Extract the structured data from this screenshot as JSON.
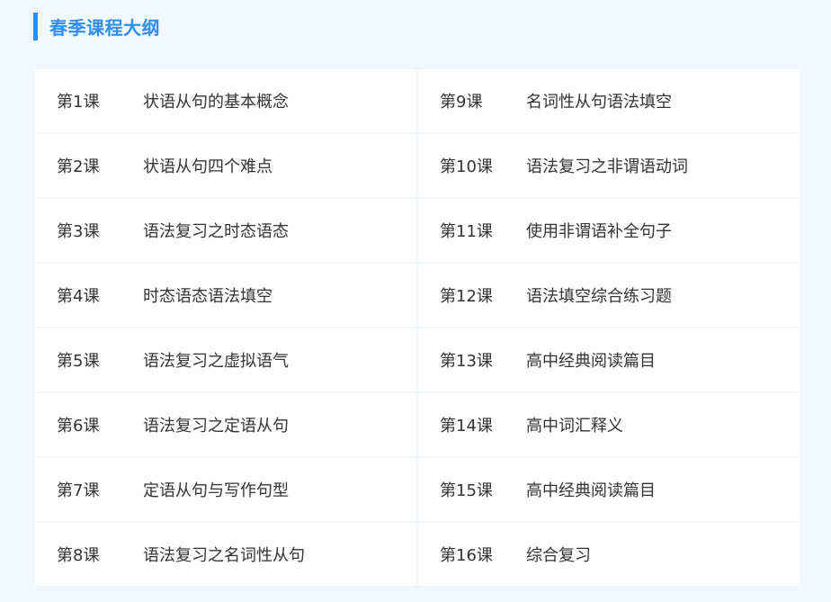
{
  "header": {
    "title": "春季课程大纲",
    "accent_color": "#2f8ef4"
  },
  "lessons": [
    {
      "num": "第1课",
      "title": "状语从句的基本概念"
    },
    {
      "num": "第9课",
      "title": "名词性从句语法填空"
    },
    {
      "num": "第2课",
      "title": "状语从句四个难点"
    },
    {
      "num": "第10课",
      "title": "语法复习之非谓语动词"
    },
    {
      "num": "第3课",
      "title": "语法复习之时态语态"
    },
    {
      "num": "第11课",
      "title": "使用非谓语补全句子"
    },
    {
      "num": "第4课",
      "title": "时态语态语法填空"
    },
    {
      "num": "第12课",
      "title": "语法填空综合练习题"
    },
    {
      "num": "第5课",
      "title": "语法复习之虚拟语气"
    },
    {
      "num": "第13课",
      "title": "高中经典阅读篇目"
    },
    {
      "num": "第6课",
      "title": "语法复习之定语从句"
    },
    {
      "num": "第14课",
      "title": "高中词汇释义"
    },
    {
      "num": "第7课",
      "title": "定语从句与写作句型"
    },
    {
      "num": "第15课",
      "title": "高中经典阅读篇目"
    },
    {
      "num": "第8课",
      "title": "语法复习之名词性从句"
    },
    {
      "num": "第16课",
      "title": "综合复习"
    }
  ]
}
